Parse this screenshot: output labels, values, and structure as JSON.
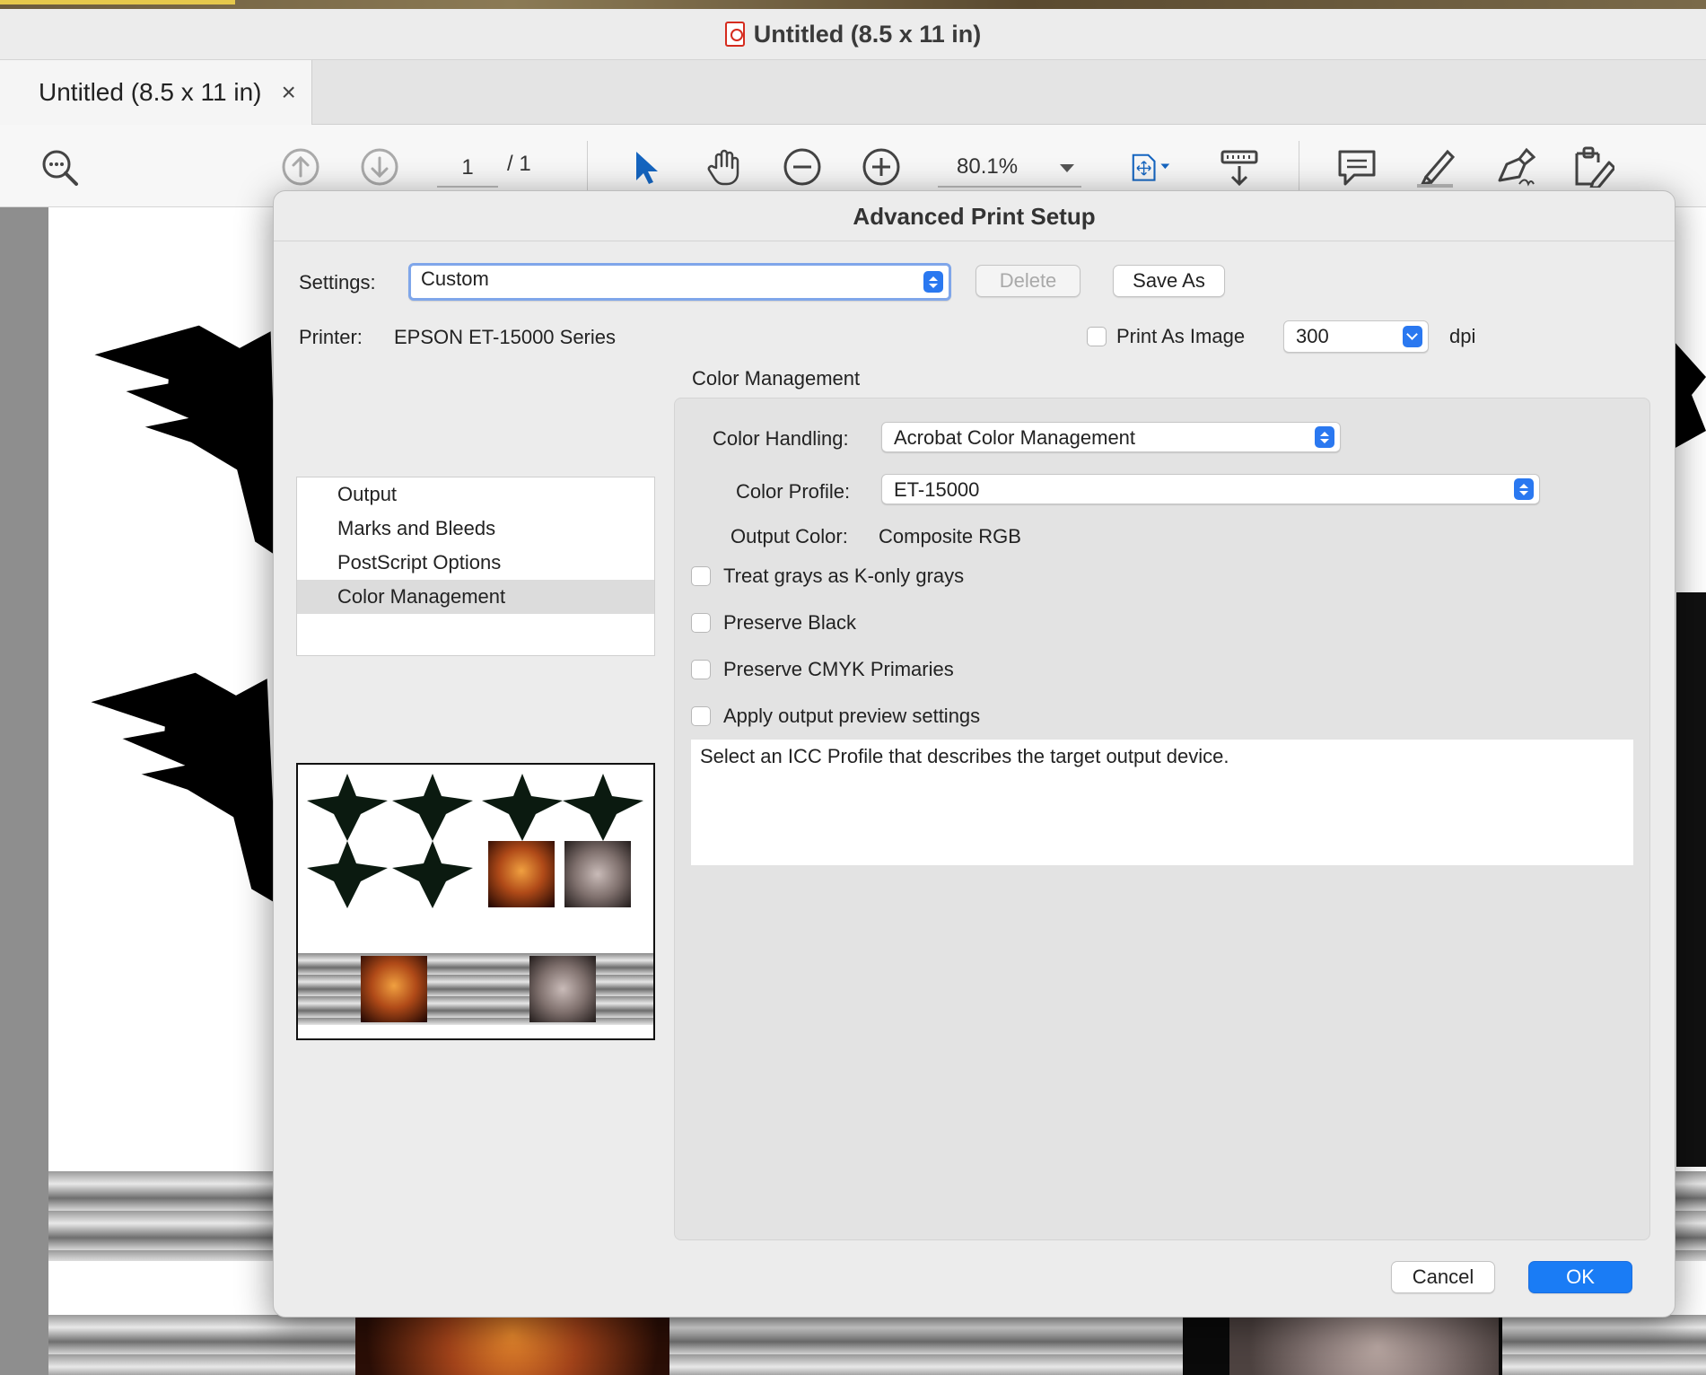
{
  "window": {
    "title": "Untitled (8.5 x 11 in)"
  },
  "tabs": [
    {
      "label": "Untitled (8.5 x 11 in)",
      "close": "×"
    }
  ],
  "toolbar": {
    "page_current": "1",
    "page_total": "/ 1",
    "zoom": "80.1%"
  },
  "dialog": {
    "title": "Advanced Print Setup",
    "settings_label": "Settings:",
    "settings_value": "Custom",
    "delete_button": "Delete",
    "save_as_button": "Save As",
    "printer_label": "Printer:",
    "printer_value": "EPSON ET-15000 Series",
    "print_as_image_label": "Print As Image",
    "dpi_value": "300",
    "dpi_unit": "dpi",
    "categories": [
      {
        "label": "Output"
      },
      {
        "label": "Marks and Bleeds"
      },
      {
        "label": "PostScript Options"
      },
      {
        "label": "Color Management"
      }
    ],
    "selected_category": "Color Management",
    "color_management": {
      "heading": "Color Management",
      "color_handling_label": "Color Handling:",
      "color_handling_value": "Acrobat Color Management",
      "color_profile_label": "Color Profile:",
      "color_profile_value": "ET-15000",
      "output_color_label": "Output Color:",
      "output_color_value": "Composite RGB",
      "options": [
        {
          "label": "Treat grays as K-only grays",
          "checked": false
        },
        {
          "label": "Preserve Black",
          "checked": false
        },
        {
          "label": "Preserve CMYK Primaries",
          "checked": false
        },
        {
          "label": "Apply output preview settings",
          "checked": false
        }
      ],
      "description": "Select an ICC Profile that describes the target output device."
    },
    "cancel_button": "Cancel",
    "ok_button": "OK"
  },
  "colors": {
    "accent": "#1a7cf5",
    "focus_ring": "#7fa6ea",
    "icon_blue": "#1565c0"
  }
}
